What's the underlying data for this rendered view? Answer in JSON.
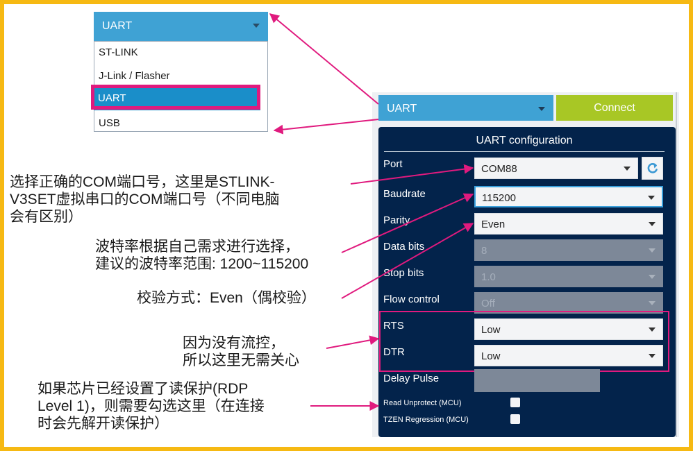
{
  "protocol_dropdown": {
    "selected": "UART",
    "options": [
      "ST-LINK",
      "J-Link / Flasher",
      "UART",
      "USB"
    ]
  },
  "connection_bar": {
    "interface_value": "UART",
    "connect_label": "Connect"
  },
  "uart_config": {
    "title": "UART configuration",
    "port": {
      "label": "Port",
      "value": "COM88"
    },
    "baudrate": {
      "label": "Baudrate",
      "value": "115200"
    },
    "parity": {
      "label": "Parity",
      "value": "Even"
    },
    "data_bits": {
      "label": "Data bits",
      "value": "8"
    },
    "stop_bits": {
      "label": "Stop bits",
      "value": "1.0"
    },
    "flow_control": {
      "label": "Flow control",
      "value": "Off"
    },
    "rts": {
      "label": "RTS",
      "value": "Low"
    },
    "dtr": {
      "label": "DTR",
      "value": "Low"
    },
    "delay_pulse": {
      "label": "Delay Pulse",
      "value": ""
    },
    "read_unprotect": {
      "label": "Read Unprotect (MCU)",
      "checked": false
    },
    "tzen_regression": {
      "label": "TZEN Regression (MCU)",
      "checked": false
    }
  },
  "annotations": {
    "port_note": [
      "选择正确的COM端口号，这里是STLINK-",
      "V3SET虚拟串口的COM端口号（不同电脑",
      "会有区别）"
    ],
    "baud_note": [
      "波特率根据自己需求进行选择，",
      "建议的波特率范围: 1200~115200"
    ],
    "parity_note": [
      "校验方式：Even（偶校验）"
    ],
    "flow_note": [
      "因为没有流控，",
      "所以这里无需关心"
    ],
    "rdp_note": [
      "如果芯片已经设置了读保护(RDP",
      "Level 1)，则需要勾选这里（在连接",
      "时会先解开读保护）"
    ]
  },
  "colors": {
    "frame": "#f6b913",
    "accent_blue": "#3fa2d4",
    "connect_green": "#a8c725",
    "config_bg": "#03234b",
    "highlight_pink": "#e01a7e"
  }
}
